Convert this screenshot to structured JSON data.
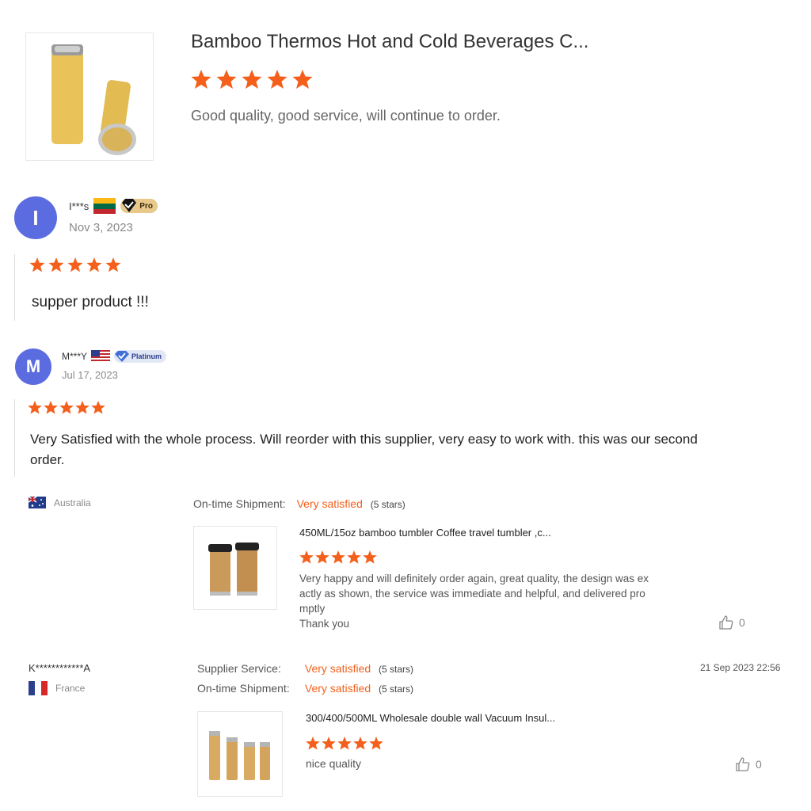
{
  "top_review": {
    "product_title": "Bamboo Thermos Hot and Cold Beverages C...",
    "rating": 5,
    "comment": "Good quality, good service, will continue to order."
  },
  "reviews": [
    {
      "avatar_letter": "I",
      "username": "I***s",
      "badge": "Pro",
      "date": "Nov 3, 2023",
      "rating": 5,
      "text": "supper product !!!"
    },
    {
      "avatar_letter": "M",
      "username": "M***Y",
      "badge": "Platinum",
      "date": "Jul 17, 2023",
      "rating": 5,
      "text": "Very Satisfied with the whole process. Will reorder with this supplier, very easy to work with. this was our second order."
    }
  ],
  "supplier_reviews": [
    {
      "country": "Australia",
      "ratings": [
        {
          "label": "On-time Shipment:",
          "value": "Very satisfied",
          "stars": "(5 stars)"
        }
      ],
      "product_title": "450ML/15oz bamboo tumbler Coffee travel tumbler ,c...",
      "rating": 5,
      "text_lines": [
        "Very happy and will definitely order again, great quality, the design was ex",
        "actly as shown, the service was immediate and helpful, and delivered pro",
        "mptly",
        "Thank you"
      ],
      "likes": "0"
    },
    {
      "username": "K************A",
      "country": "France",
      "timestamp": "21 Sep 2023 22:56",
      "ratings": [
        {
          "label": "Supplier Service:",
          "value": "Very satisfied",
          "stars": "(5 stars)"
        },
        {
          "label": "On-time Shipment:",
          "value": "Very satisfied",
          "stars": "(5 stars)"
        }
      ],
      "product_title": "300/400/500ML Wholesale double wall Vacuum Insul...",
      "rating": 5,
      "text": "nice quality",
      "likes": "0"
    }
  ],
  "colors": {
    "star": "#f4601b",
    "accent_text": "#f4601b",
    "avatar": "#5b6ce0"
  },
  "icons": [
    "star-icon",
    "thumbs-up-icon",
    "flag-icon",
    "pro-badge-icon",
    "platinum-badge-icon"
  ]
}
